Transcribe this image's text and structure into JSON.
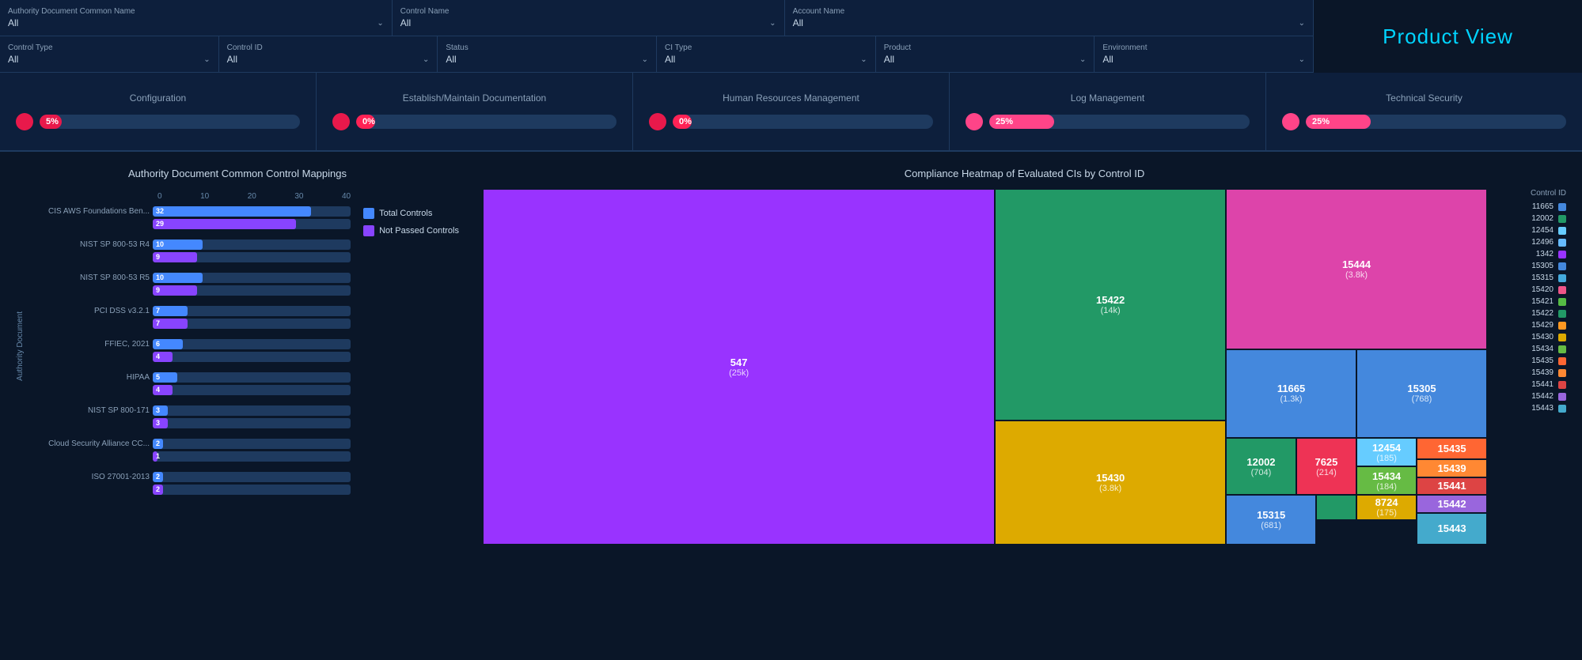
{
  "header": {
    "product_view_title": "Product View",
    "row1": {
      "filters": [
        {
          "label": "Authority Document Common Name",
          "value": "All"
        },
        {
          "label": "Control Name",
          "value": "All"
        },
        {
          "label": "Account Name",
          "value": "All"
        }
      ]
    },
    "row2": {
      "filters": [
        {
          "label": "Control Type",
          "value": "All"
        },
        {
          "label": "Control ID",
          "value": "All"
        },
        {
          "label": "Status",
          "value": "All"
        },
        {
          "label": "CI Type",
          "value": "All"
        },
        {
          "label": "Product",
          "value": "All"
        },
        {
          "label": "Environment",
          "value": "All"
        }
      ]
    }
  },
  "categories": [
    {
      "name": "Configuration",
      "percent": "5%",
      "fill_class": "fill-5"
    },
    {
      "name": "Establish/Maintain Documentation",
      "percent": "0%",
      "fill_class": "fill-0a"
    },
    {
      "name": "Human Resources Management",
      "percent": "0%",
      "fill_class": "fill-0b"
    },
    {
      "name": "Log Management",
      "percent": "25%",
      "fill_class": "fill-25a"
    },
    {
      "name": "Technical Security",
      "percent": "25%",
      "fill_class": "fill-25b"
    }
  ],
  "bar_chart": {
    "title": "Authority Document Common Control Mappings",
    "y_axis_label": "Authority Document",
    "x_axis_ticks": [
      "0",
      "10",
      "20",
      "30",
      "40"
    ],
    "legend": [
      {
        "label": "Total Controls",
        "color_class": "legend-total"
      },
      {
        "label": "Not Passed Controls",
        "color_class": "legend-failed"
      }
    ],
    "bars": [
      {
        "label": "CIS AWS Foundations Ben...",
        "total": 32,
        "failed": 29
      },
      {
        "label": "NIST SP 800-53 R4",
        "total": 10,
        "failed": 9
      },
      {
        "label": "NIST SP 800-53 R5",
        "total": 10,
        "failed": 9
      },
      {
        "label": "PCI DSS v3.2.1",
        "total": 7,
        "failed": 7
      },
      {
        "label": "FFIEC, 2021",
        "total": 6,
        "failed": 4
      },
      {
        "label": "HIPAA",
        "total": 5,
        "failed": 4
      },
      {
        "label": "NIST SP 800-171",
        "total": 3,
        "failed": 3
      },
      {
        "label": "Cloud Security Alliance CC...",
        "total": 2,
        "failed": 1
      },
      {
        "label": "ISO 27001-2013",
        "total": 2,
        "failed": 2
      }
    ],
    "max_value": 40
  },
  "heatmap": {
    "title": "Compliance Heatmap of Evaluated CIs by Control ID",
    "legend_title": "Control ID",
    "cells": [
      {
        "id": "547",
        "sub": "(25k)",
        "color": "#9933ff",
        "left": "0%",
        "top": "0%",
        "width": "51%",
        "height": "100%"
      },
      {
        "id": "15422",
        "sub": "(14k)",
        "color": "#229966",
        "left": "51%",
        "top": "0%",
        "width": "23%",
        "height": "65%"
      },
      {
        "id": "15444",
        "sub": "(3.8k)",
        "color": "#dd44aa",
        "left": "74%",
        "top": "0%",
        "width": "26%",
        "height": "45%"
      },
      {
        "id": "15430",
        "sub": "(3.8k)",
        "color": "#ddaa00",
        "left": "51%",
        "top": "65%",
        "width": "23%",
        "height": "35%"
      },
      {
        "id": "11665",
        "sub": "(1.3k)",
        "color": "#4488dd",
        "left": "74%",
        "top": "45%",
        "width": "13%",
        "height": "25%"
      },
      {
        "id": "15305",
        "sub": "(768)",
        "color": "#4488dd",
        "left": "87%",
        "top": "45%",
        "width": "13%",
        "height": "25%"
      },
      {
        "id": "12002",
        "sub": "(704)",
        "color": "#229966",
        "left": "74%",
        "top": "70%",
        "width": "7%",
        "height": "16%"
      },
      {
        "id": "7625",
        "sub": "(214)",
        "color": "#ee3355",
        "left": "81%",
        "top": "70%",
        "width": "6%",
        "height": "16%"
      },
      {
        "id": "15315",
        "sub": "(681)",
        "color": "#4488dd",
        "left": "74%",
        "top": "86%",
        "width": "9%",
        "height": "14%"
      },
      {
        "id": "8724",
        "sub": "(175)",
        "color": "#ddaa00",
        "left": "87%",
        "top": "86%",
        "width": "6%",
        "height": "7%"
      },
      {
        "id": "12454",
        "sub": "(185)",
        "color": "#66ccff",
        "left": "87%",
        "top": "70%",
        "width": "6%",
        "height": "8%"
      },
      {
        "id": "15434",
        "sub": "(184)",
        "color": "#66bb44",
        "left": "87%",
        "top": "78%",
        "width": "6%",
        "height": "8%"
      },
      {
        "id": "15422b",
        "sub": "",
        "color": "#229966",
        "left": "83%",
        "top": "86%",
        "width": "4%",
        "height": "7%"
      },
      {
        "id": "15435",
        "sub": "",
        "color": "#ff6633",
        "left": "93%",
        "top": "70%",
        "width": "7%",
        "height": "6%"
      },
      {
        "id": "15439",
        "sub": "",
        "color": "#ff8833",
        "left": "93%",
        "top": "76%",
        "width": "7%",
        "height": "5%"
      },
      {
        "id": "15441",
        "sub": "",
        "color": "#dd4444",
        "left": "93%",
        "top": "81%",
        "width": "7%",
        "height": "5%"
      },
      {
        "id": "15442",
        "sub": "",
        "color": "#9966dd",
        "left": "93%",
        "top": "86%",
        "width": "7%",
        "height": "5%"
      },
      {
        "id": "15443",
        "sub": "",
        "color": "#44aacc",
        "left": "93%",
        "top": "91%",
        "width": "7%",
        "height": "9%"
      }
    ],
    "legend_items": [
      {
        "id": "11665",
        "color": "#4488dd"
      },
      {
        "id": "12002",
        "color": "#229966"
      },
      {
        "id": "12454",
        "color": "#66ccff"
      },
      {
        "id": "12496",
        "color": "#66bbff"
      },
      {
        "id": "1342",
        "color": "#9933ff"
      },
      {
        "id": "15305",
        "color": "#4488dd"
      },
      {
        "id": "15315",
        "color": "#44aadd"
      },
      {
        "id": "15420",
        "color": "#ee5588"
      },
      {
        "id": "15421",
        "color": "#55bb44"
      },
      {
        "id": "15422",
        "color": "#229966"
      },
      {
        "id": "15429",
        "color": "#ff9922"
      },
      {
        "id": "15430",
        "color": "#ddaa00"
      },
      {
        "id": "15434",
        "color": "#66bb44"
      },
      {
        "id": "15435",
        "color": "#ff6633"
      },
      {
        "id": "15439",
        "color": "#ff8833"
      },
      {
        "id": "15441",
        "color": "#dd4444"
      },
      {
        "id": "15442",
        "color": "#9966dd"
      },
      {
        "id": "15443",
        "color": "#44aacc"
      }
    ]
  }
}
